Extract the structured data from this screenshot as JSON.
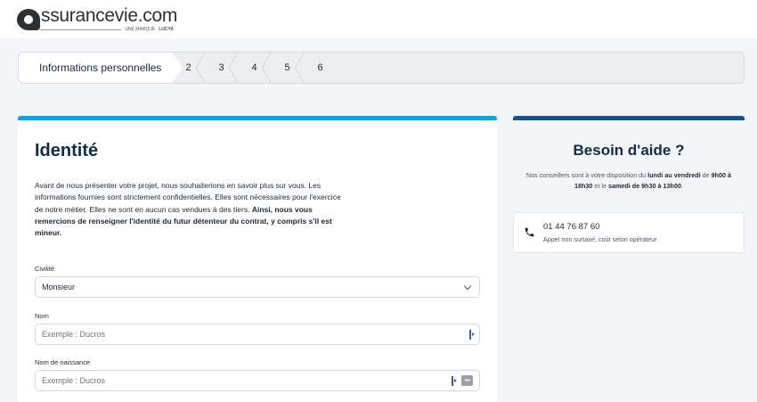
{
  "brand": {
    "name": "ssurancevie.com",
    "tagline_prefix": "UNE MARQUE",
    "tagline_brand": "LUCYA"
  },
  "stepper": {
    "active_label": "Informations personnelles",
    "steps": [
      "2",
      "3",
      "4",
      "5",
      "6"
    ]
  },
  "identity": {
    "title": "Identité",
    "intro": "Avant de nous présenter votre projet, nous souhaiterions en savoir plus sur vous. Les informations fournies sont strictement confidentielles. Elles sont nécessaires pour l'exercice de notre métier. Elles ne sont en aucun cas vendues à des tiers. ",
    "intro_bold": "Ainsi, nous vous remercions de renseigner l'identité du futur détenteur du contrat, y compris s'il est mineur.",
    "civility": {
      "label": "Civilité",
      "value": "Monsieur"
    },
    "last_name": {
      "label": "Nom",
      "placeholder": "Exemple : Ducros"
    },
    "birth_name": {
      "label": "Nom de naissance",
      "placeholder": "Exemple : Ducros"
    }
  },
  "help": {
    "title": "Besoin d'aide ?",
    "text_1": "Nos conseillers sont à votre disposition du ",
    "text_days": "lundi au vendredi",
    "text_2": " de ",
    "text_hours1": "9h00 à 18h30",
    "text_3": " et le ",
    "text_sat": "samedi de 9h30 à 13h00",
    "text_4": ".",
    "phone": "01 44 76 87 60",
    "phone_note": "Appel non surtaxé, coût selon opérateur"
  },
  "colors": {
    "accent_blue": "#1a9fdc",
    "dark_blue": "#1b4e8e",
    "title_navy": "#112e44"
  }
}
